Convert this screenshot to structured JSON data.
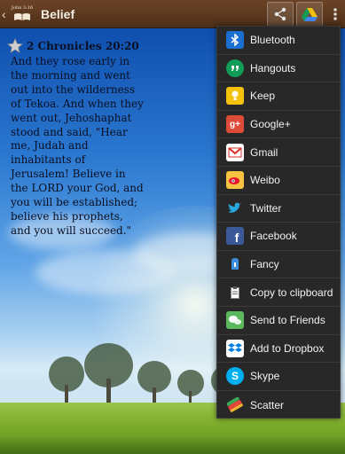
{
  "header": {
    "app_logo_text": "John 3:16",
    "title": "Belief",
    "actions": [
      {
        "name": "share-icon"
      },
      {
        "name": "google-drive-icon"
      },
      {
        "name": "overflow-menu-icon"
      }
    ]
  },
  "verse": {
    "reference": "2 Chronicles 20:20",
    "text": "And they rose early in the morning and went out into the wilderness of Tekoa. And when they went out, Jehoshaphat stood and said, \"Hear me, Judah and inhabitants of Jerusalem! Believe in the LORD your God, and you will be established; believe his prophets, and you will succeed.\""
  },
  "share_menu": {
    "items": [
      {
        "label": "Bluetooth",
        "icon": "bluetooth-icon",
        "color": "#1b6fd1"
      },
      {
        "label": "Hangouts",
        "icon": "hangouts-icon",
        "color": "#0f9d58"
      },
      {
        "label": "Keep",
        "icon": "keep-icon",
        "color": "#f4c20d"
      },
      {
        "label": "Google+",
        "icon": "google-plus-icon",
        "color": "#dd4b39"
      },
      {
        "label": "Gmail",
        "icon": "gmail-icon",
        "color": "#ffffff"
      },
      {
        "label": "Weibo",
        "icon": "weibo-icon",
        "color": "#f5c242"
      },
      {
        "label": "Twitter",
        "icon": "twitter-icon",
        "color": "#2aa9e0"
      },
      {
        "label": "Facebook",
        "icon": "facebook-icon",
        "color": "#3b5998"
      },
      {
        "label": "Fancy",
        "icon": "fancy-icon",
        "color": "#3e8ede"
      },
      {
        "label": "Copy to clipboard",
        "icon": "clipboard-icon",
        "color": "#ffffff"
      },
      {
        "label": "Send to Friends",
        "icon": "send-to-friends-icon",
        "color": "#5cb85c"
      },
      {
        "label": "Add to Dropbox",
        "icon": "dropbox-icon",
        "color": "#007ee5"
      },
      {
        "label": "Skype",
        "icon": "skype-icon",
        "color": "#00aff0"
      },
      {
        "label": "Scatter",
        "icon": "scatter-icon",
        "color": "#e2463c"
      }
    ]
  }
}
